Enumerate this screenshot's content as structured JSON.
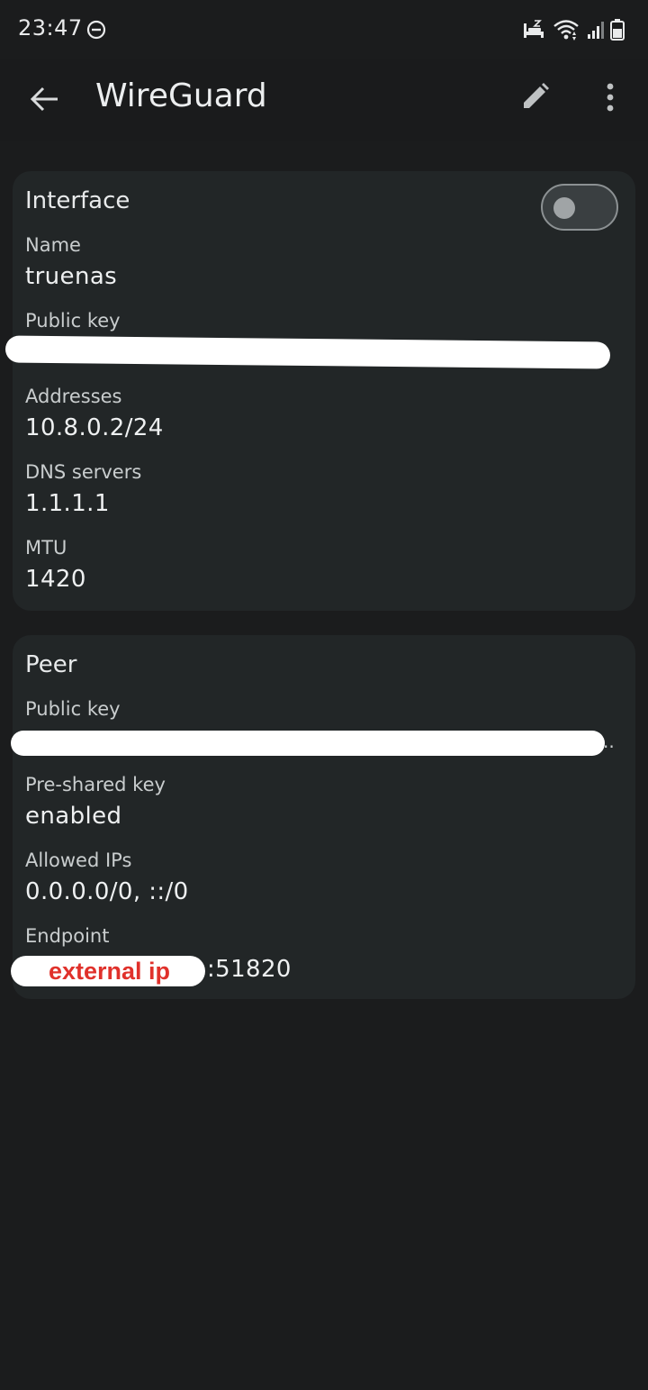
{
  "status_bar": {
    "time": "23:47"
  },
  "app_bar": {
    "title": "WireGuard",
    "icons": [
      "back-arrow-icon",
      "edit-pencil-icon",
      "more-vert-icon"
    ]
  },
  "interface": {
    "title": "Interface",
    "enabled": false,
    "name_label": "Name",
    "name_value": "truenas",
    "public_key_label": "Public key",
    "addresses_label": "Addresses",
    "addresses_value": "10.8.0.2/24",
    "dns_label": "DNS servers",
    "dns_value": "1.1.1.1",
    "mtu_label": "MTU",
    "mtu_value": "1420"
  },
  "peer": {
    "title": "Peer",
    "public_key_label": "Public key",
    "public_key_tail": "..",
    "psk_label": "Pre-shared key",
    "psk_value": "enabled",
    "allowed_ips_label": "Allowed IPs",
    "allowed_ips_value": "0.0.0.0/0, ::/0",
    "endpoint_label": "Endpoint",
    "endpoint_note": "external ip",
    "endpoint_port": ":51820"
  },
  "colors": {
    "background": "#1b1c1d",
    "card": "#222627",
    "annotation_red": "#e0312b"
  }
}
